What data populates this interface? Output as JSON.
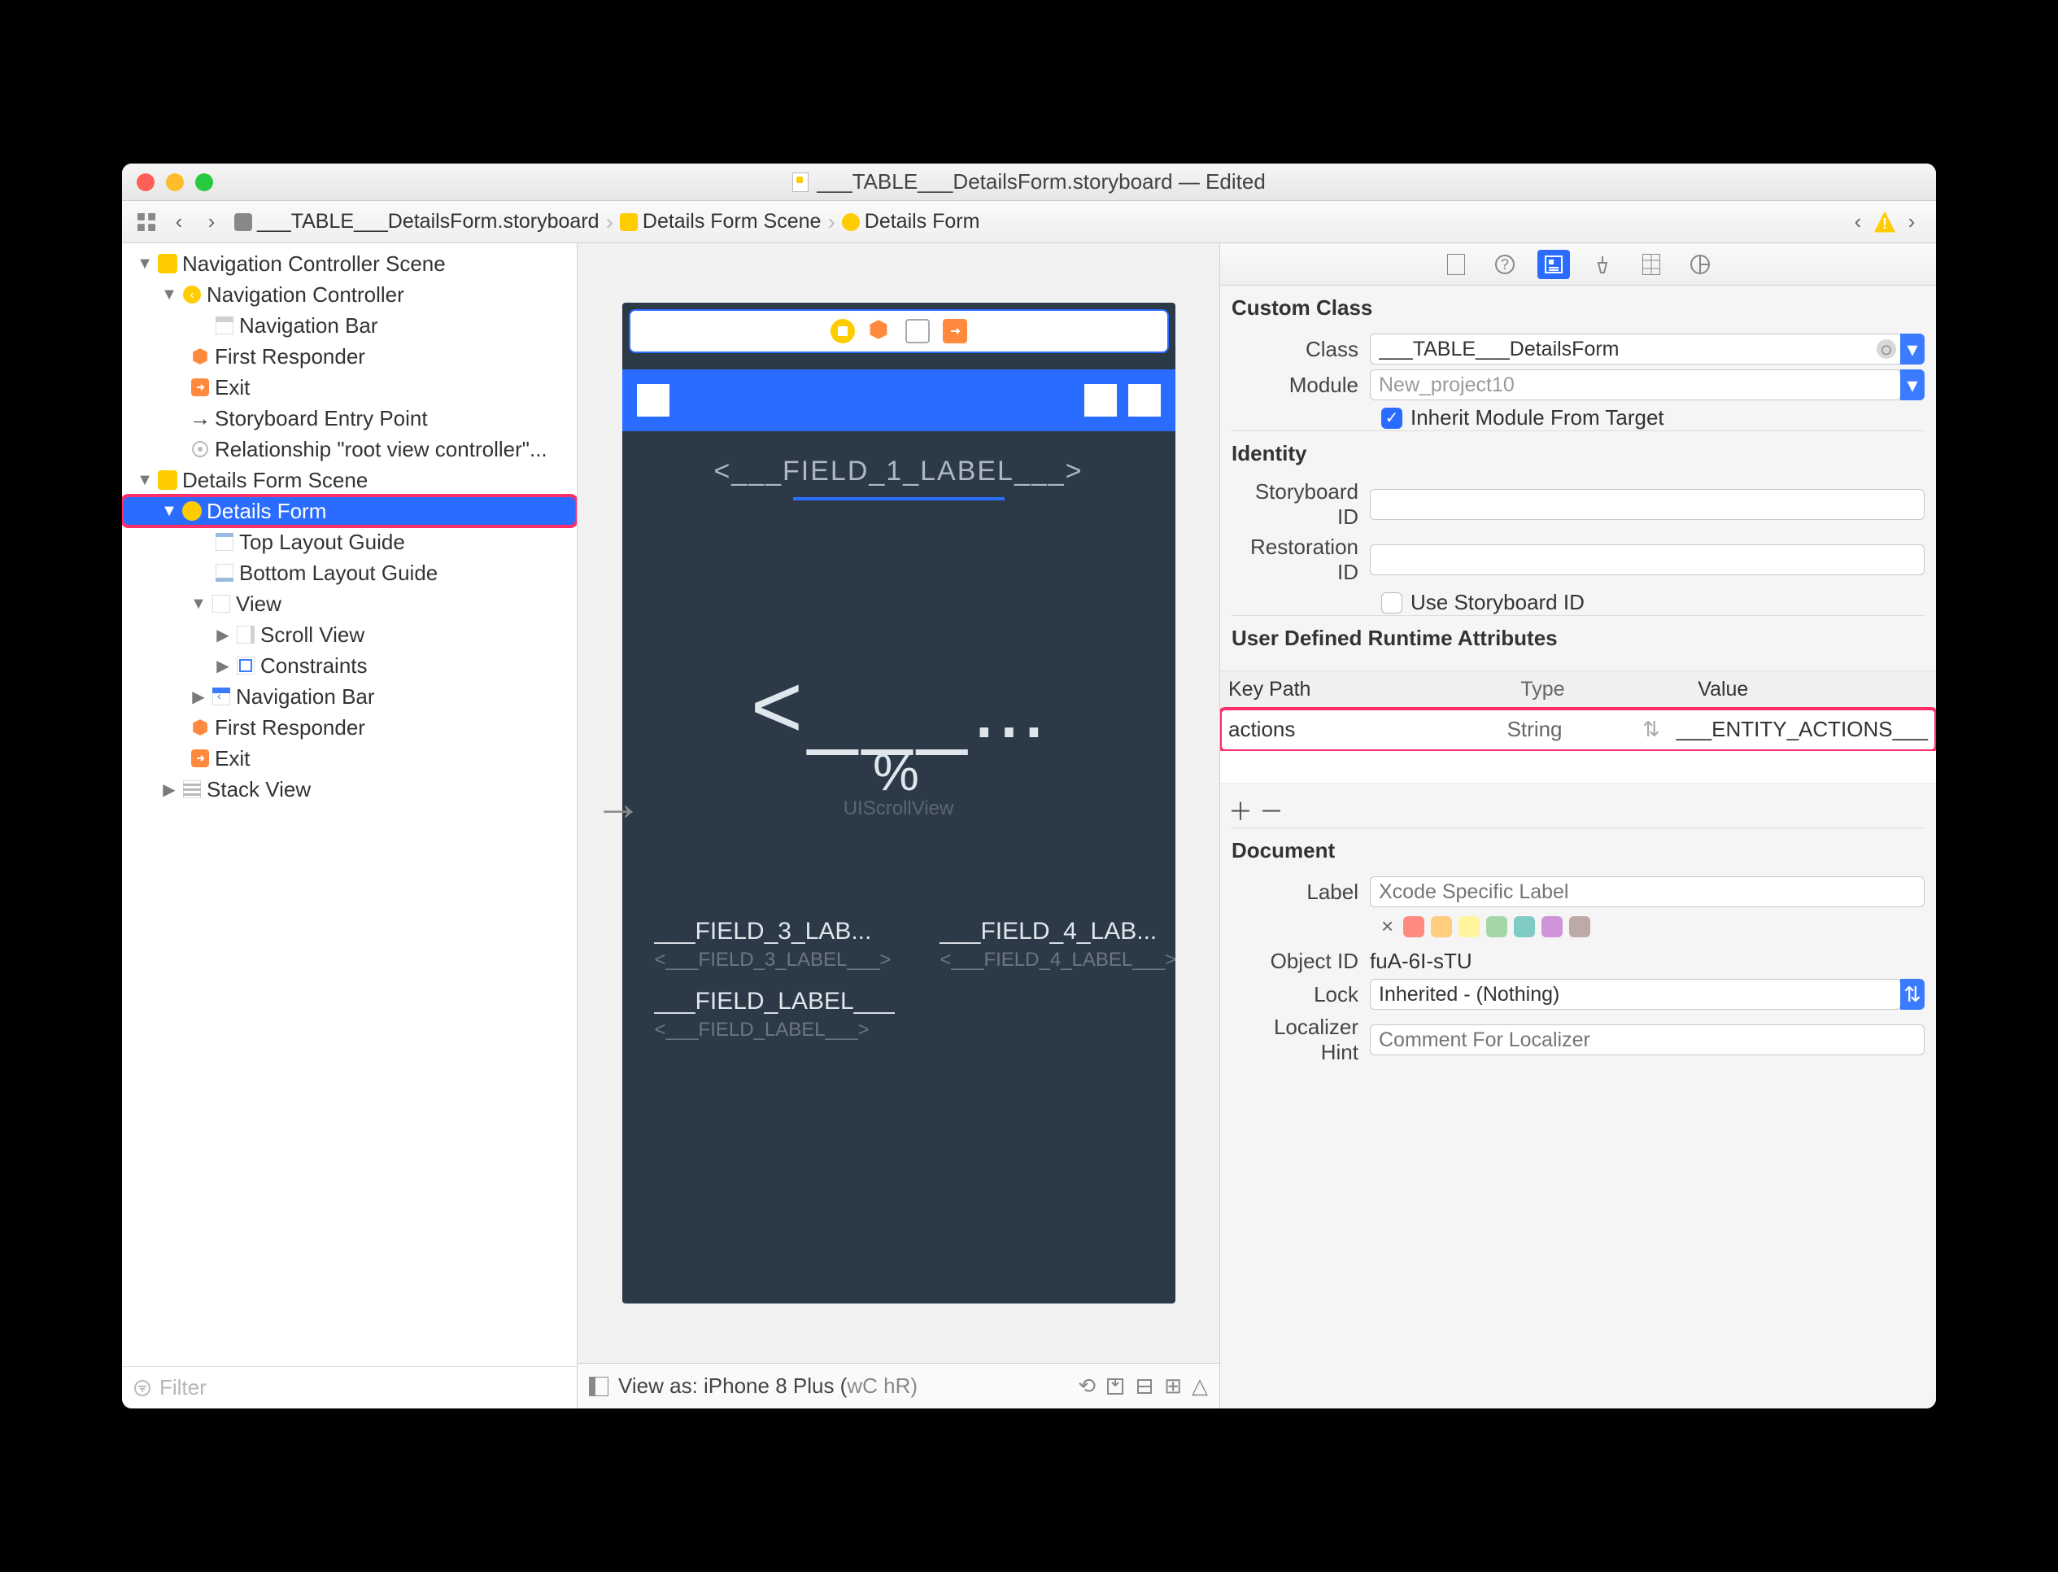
{
  "window": {
    "title": "___TABLE___DetailsForm.storyboard — Edited"
  },
  "breadcrumb": {
    "file": "___TABLE___DetailsForm.storyboard",
    "scene": "Details Form Scene",
    "form": "Details Form"
  },
  "outline": {
    "nav_scene": "Navigation Controller Scene",
    "nav_controller": "Navigation Controller",
    "nav_bar": "Navigation Bar",
    "first_responder": "First Responder",
    "exit": "Exit",
    "entry_point": "Storyboard Entry Point",
    "relationship": "Relationship \"root view controller\"...",
    "details_scene": "Details Form Scene",
    "details_form": "Details Form",
    "top_guide": "Top Layout Guide",
    "bottom_guide": "Bottom Layout Guide",
    "view": "View",
    "scroll_view": "Scroll View",
    "constraints": "Constraints",
    "nav_bar2": "Navigation Bar",
    "first_responder2": "First Responder",
    "exit2": "Exit",
    "stack_view": "Stack View",
    "filter_placeholder": "Filter"
  },
  "canvas": {
    "field1": "<___FIELD_1_LABEL___>",
    "big_symbol": "<___",
    "big_dots": "...",
    "percent": "%",
    "scrollview": "UIScrollView",
    "f3": "___FIELD_3_LAB...",
    "f3s": "<___FIELD_3_LABEL___>",
    "f4": "___FIELD_4_LAB...",
    "f4s": "<___FIELD_4_LABEL___>",
    "fl": "___FIELD_LABEL___",
    "fls": "<___FIELD_LABEL___>",
    "view_as": "View as: iPhone 8 Plus (",
    "wc": "wC",
    "hr": "hR)"
  },
  "inspector": {
    "custom_class_h": "Custom Class",
    "class_label": "Class",
    "class_value": "___TABLE___DetailsForm",
    "module_label": "Module",
    "module_value": "New_project10",
    "inherit": "Inherit Module From Target",
    "identity_h": "Identity",
    "sb_id": "Storyboard ID",
    "rest_id": "Restoration ID",
    "use_sb": "Use Storyboard ID",
    "udra_h": "User Defined Runtime Attributes",
    "col_kp": "Key Path",
    "col_type": "Type",
    "col_val": "Value",
    "row_kp": "actions",
    "row_type": "String",
    "row_val": "___ENTITY_ACTIONS___",
    "doc_h": "Document",
    "label_label": "Label",
    "label_ph": "Xcode Specific Label",
    "object_id_label": "Object ID",
    "object_id": "fuA-6I-sTU",
    "lock_label": "Lock",
    "lock_value": "Inherited - (Nothing)",
    "loc_label": "Localizer Hint",
    "loc_ph": "Comment For Localizer"
  },
  "swatches": [
    "#ff8a80",
    "#ffcc80",
    "#fff59d",
    "#a5d6a7",
    "#80cbc4",
    "#ce93d8",
    "#bcaaa4"
  ]
}
